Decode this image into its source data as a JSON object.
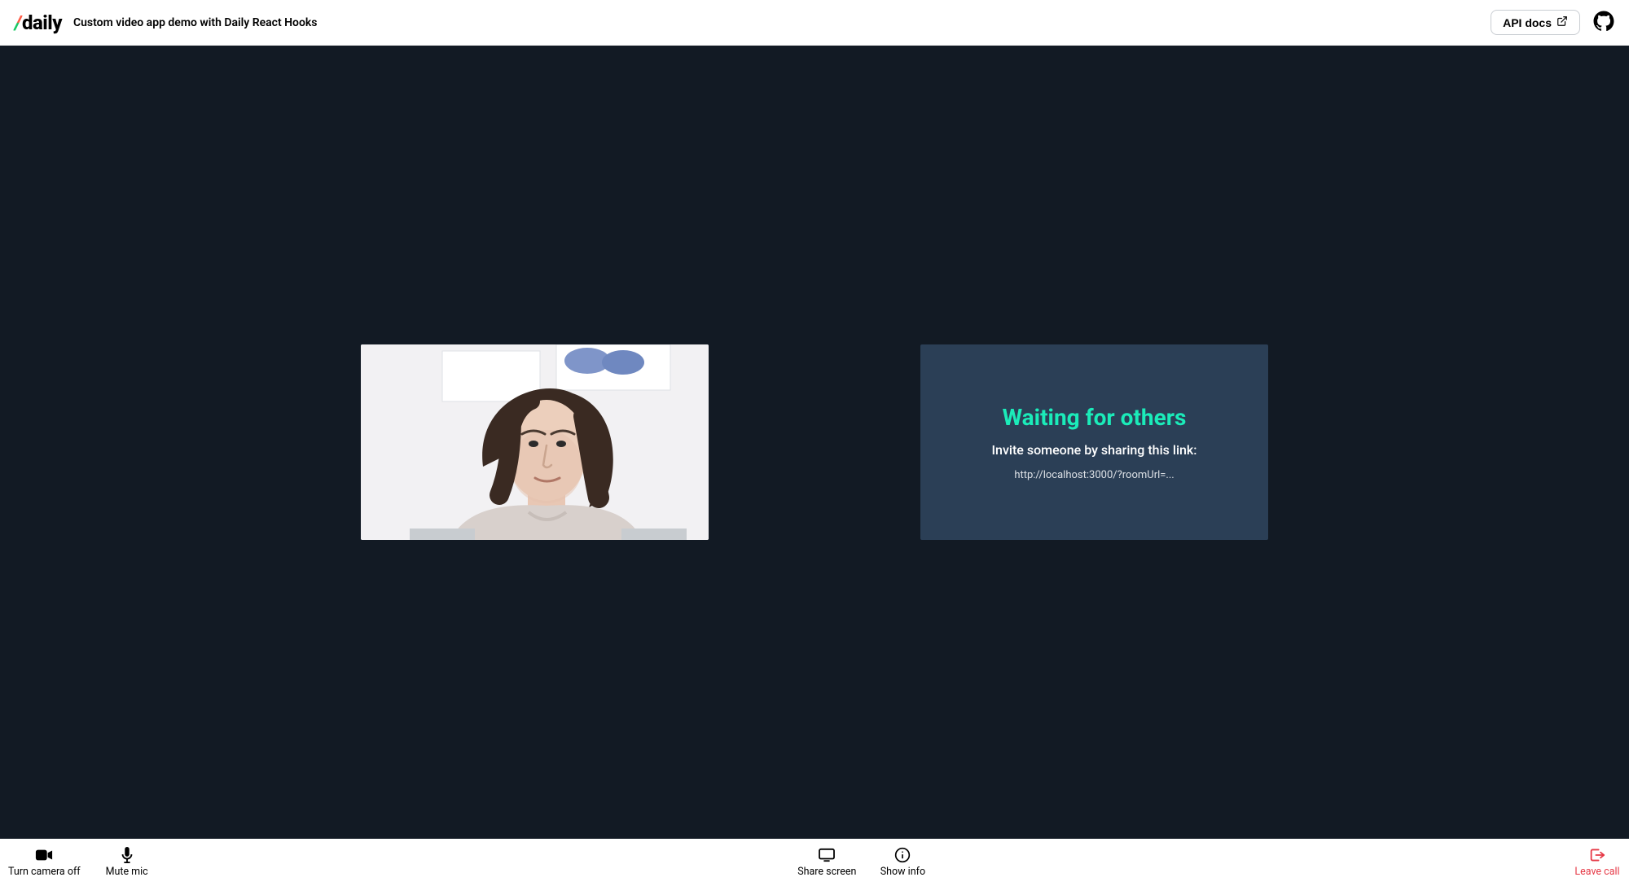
{
  "header": {
    "brand": "daily",
    "title": "Custom video app demo with Daily React Hooks",
    "api_docs_label": "API docs"
  },
  "stage": {
    "waiting": {
      "title": "Waiting for others",
      "subtitle": "Invite someone by sharing this link:",
      "link": "http://localhost:3000/?roomUrl=..."
    }
  },
  "tray": {
    "camera_label": "Turn camera off",
    "mic_label": "Mute mic",
    "share_label": "Share screen",
    "info_label": "Show info",
    "leave_label": "Leave call"
  },
  "colors": {
    "stage_bg": "#121a24",
    "waiting_bg": "#2b3f56",
    "accent": "#1bebb9",
    "danger": "#e63946"
  }
}
